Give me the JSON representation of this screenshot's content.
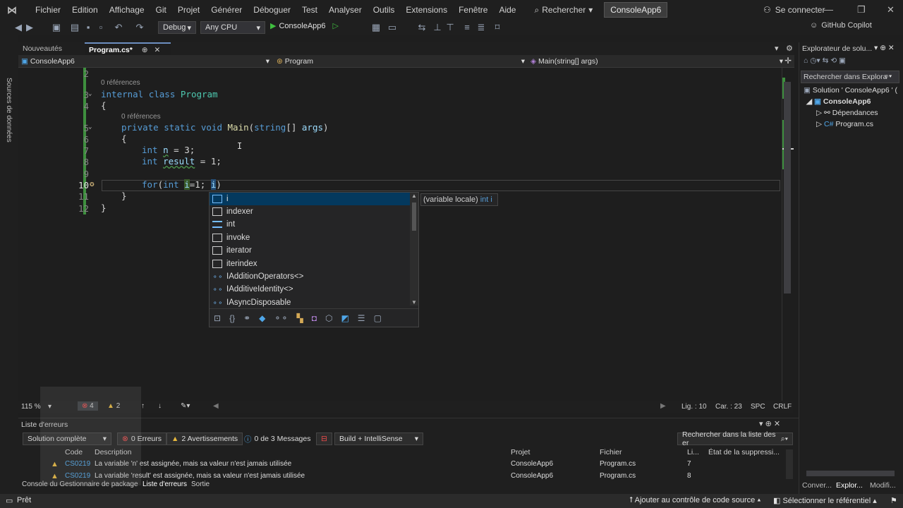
{
  "menu": {
    "items": [
      "Fichier",
      "Edition",
      "Affichage",
      "Git",
      "Projet",
      "Générer",
      "Déboguer",
      "Test",
      "Analyser",
      "Outils",
      "Extensions",
      "Fenêtre",
      "Aide"
    ],
    "search_label": "Rechercher",
    "solution_name": "ConsoleApp6",
    "connect_label": "Se connecter"
  },
  "toolbar": {
    "config": "Debug",
    "platform": "Any CPU",
    "run_label": "ConsoleApp6",
    "copilot": "GitHub Copilot"
  },
  "left_strip_label": "Sources de données",
  "tabs": {
    "nouveautes": "Nouveautés",
    "program": "Program.cs*",
    "pin": "⊕"
  },
  "navbar": {
    "project": "ConsoleApp6",
    "class": "Program",
    "member": "Main(string[] args)"
  },
  "code": {
    "line_numbers": [
      "2",
      "3",
      "4",
      "5",
      "6",
      "7",
      "8",
      "9",
      "10",
      "11",
      "12"
    ],
    "refs1": "0 références",
    "refs2": "0 références"
  },
  "completion": {
    "items": [
      "i",
      "indexer",
      "int",
      "invoke",
      "iterator",
      "iterindex",
      "IAdditionOperators<>",
      "IAdditiveIdentity<>",
      "IAsyncDisposable"
    ],
    "quickinfo_prefix": "(variable locale)",
    "quickinfo_type": "int i"
  },
  "editor_status": {
    "zoom": "115 %",
    "errors": "4",
    "warnings": "2",
    "line": "Lig. : 10",
    "char": "Car. : 23",
    "spc": "SPC",
    "crlf": "CRLF"
  },
  "solution_explorer": {
    "title": "Explorateur de solu...",
    "search": "Rechercher dans Explora",
    "solution": "Solution ' ConsoleApp6 ' (",
    "project": "ConsoleApp6",
    "deps": "Dépendances",
    "file": "Program.cs",
    "tabs": [
      "Conver...",
      "Explor...",
      "Modifi..."
    ]
  },
  "error_list": {
    "title": "Liste d'erreurs",
    "scope": "Solution complète",
    "errors": "0 Erreurs",
    "warnings": "2 Avertissements",
    "messages": "0 de 3 Messages",
    "build": "Build + IntelliSense",
    "search": "Rechercher dans la liste des er",
    "columns": [
      "Code",
      "Description",
      "Projet",
      "Fichier",
      "Li...",
      "État de la suppressi..."
    ],
    "rows": [
      {
        "code": "CS0219",
        "desc": "La variable 'n' est assignée, mais sa valeur n'est jamais utilisée",
        "project": "ConsoleApp6",
        "file": "Program.cs",
        "line": "7"
      },
      {
        "code": "CS0219",
        "desc": "La variable 'result' est assignée, mais sa valeur n'est jamais utilisée",
        "project": "ConsoleApp6",
        "file": "Program.cs",
        "line": "8"
      }
    ]
  },
  "bottom_tabs": [
    "Console du Gestionnaire de package",
    "Liste d'erreurs",
    "Sortie"
  ],
  "statusbar": {
    "ready": "Prêt",
    "source_control": "Ajouter au contrôle de code source",
    "repo": "Sélectionner le référentiel"
  }
}
